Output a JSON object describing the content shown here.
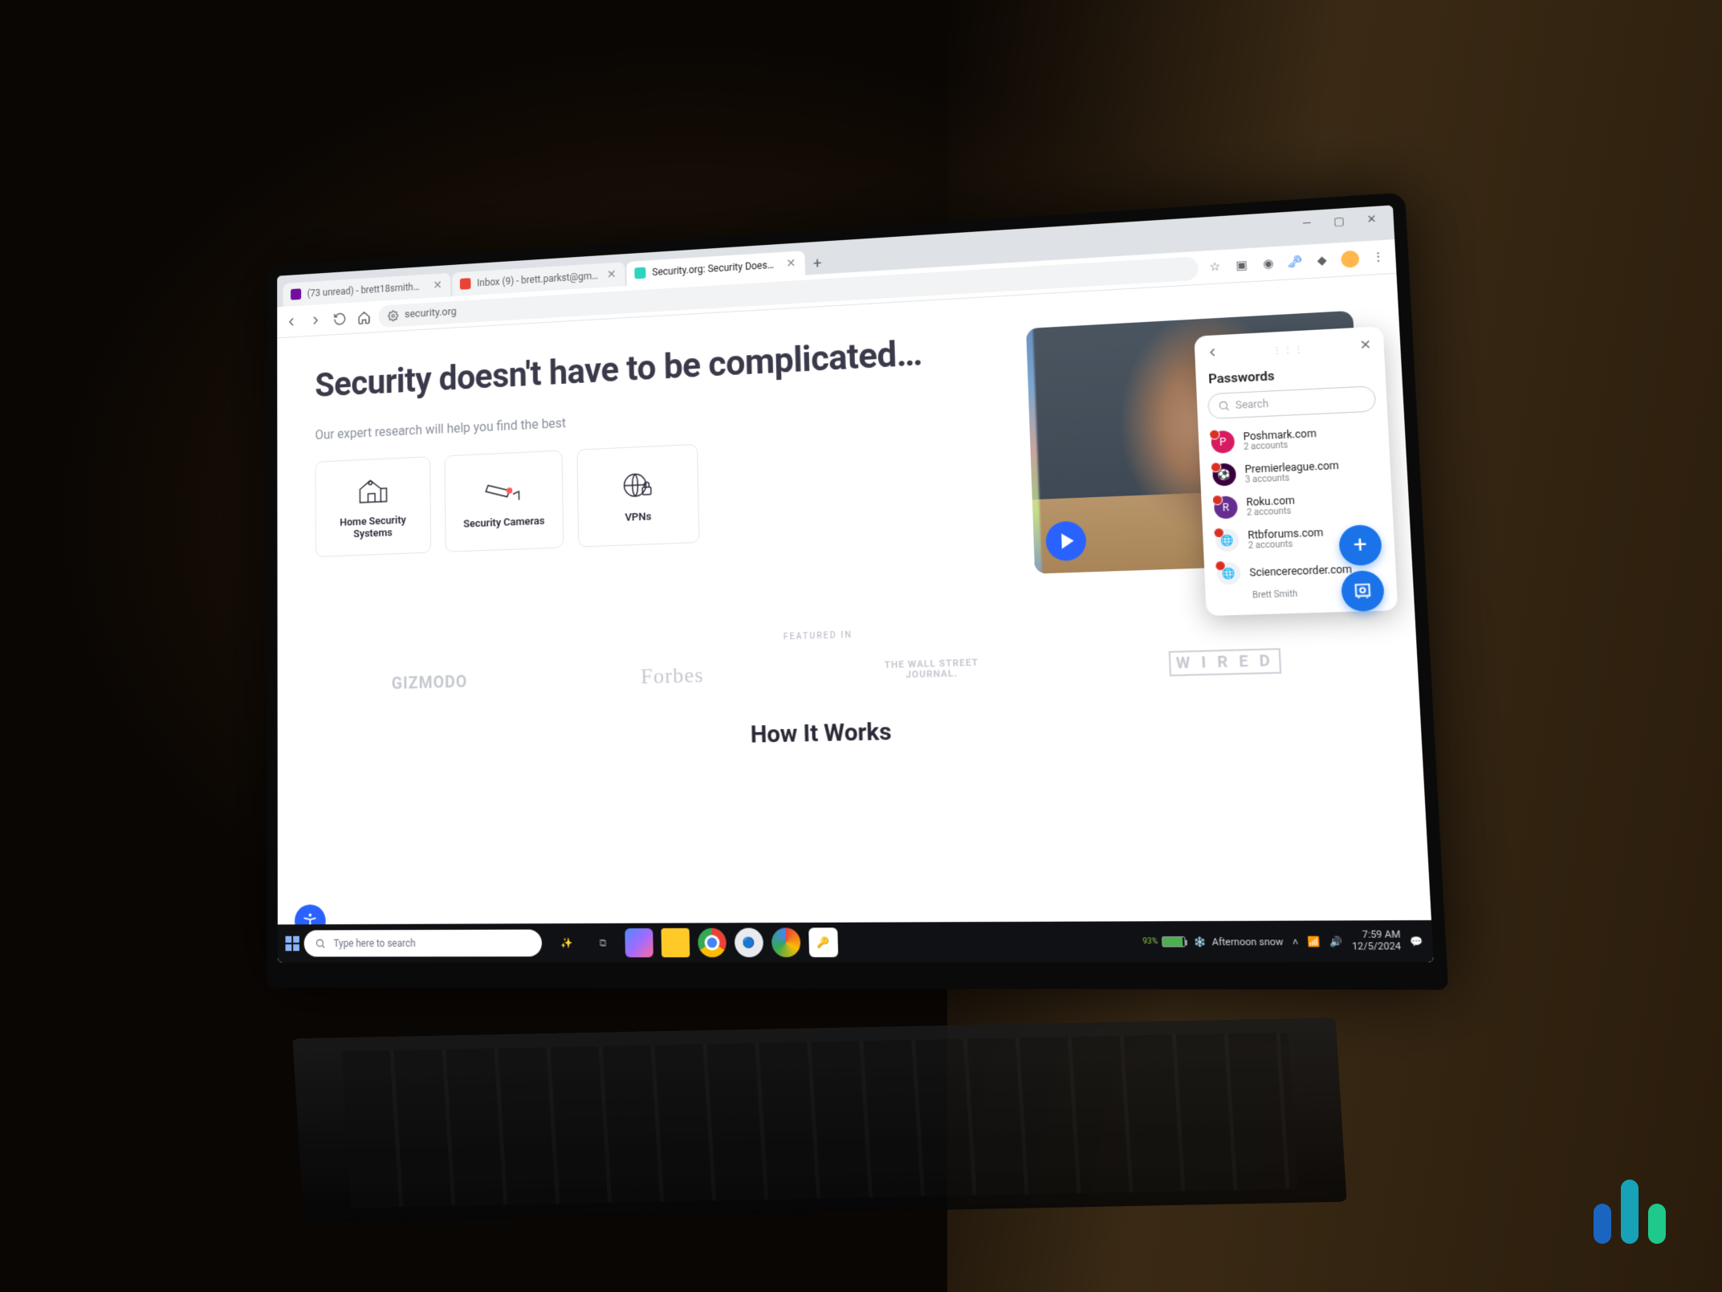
{
  "browser": {
    "tabs": [
      {
        "title": "(73 unread) - brett18smith@ya…",
        "favicon_color": "#720e9e"
      },
      {
        "title": "Inbox (9) - brett.parkst@gmail…",
        "favicon_color": "#ea4335"
      },
      {
        "title": "Security.org: Security Doesn't H…",
        "favicon_color": "#2dd4bf",
        "active": true
      }
    ],
    "url": "security.org"
  },
  "page": {
    "headline": "Security doesn't have to be complicated…",
    "subhead": "Our expert research will help you find the best",
    "cards": [
      {
        "label": "Home Security Systems"
      },
      {
        "label": "Security Cameras"
      },
      {
        "label": "VPNs"
      }
    ],
    "featured_label": "Featured In",
    "logos": {
      "gizmodo": "GIZMODO",
      "forbes": "Forbes",
      "wsj_line1": "THE WALL STREET",
      "wsj_line2": "JOURNAL.",
      "wired": "W I R E D"
    },
    "how_it_works": "How It Works"
  },
  "passwords": {
    "title": "Passwords",
    "search_placeholder": "Search",
    "items": [
      {
        "domain": "Poshmark.com",
        "count": "2 accounts",
        "icon_bg": "#d81b60",
        "icon_text": "P"
      },
      {
        "domain": "Premierleague.com",
        "count": "3 accounts",
        "icon_bg": "#38003c",
        "icon_text": "⚽"
      },
      {
        "domain": "Roku.com",
        "count": "2 accounts",
        "icon_bg": "#662d91",
        "icon_text": "R"
      },
      {
        "domain": "Rtbforums.com",
        "count": "2 accounts",
        "icon_bg": "#eef1f6",
        "icon_text": "🌐"
      },
      {
        "domain": "Sciencerecorder.com",
        "count": "",
        "icon_bg": "#eef1f6",
        "icon_text": "🌐"
      }
    ],
    "user": "Brett Smith"
  },
  "taskbar": {
    "search_placeholder": "Type here to search",
    "weather_text": "Afternoon snow",
    "battery_pct": "93%",
    "time": "7:59 AM",
    "date": "12/5/2024"
  }
}
